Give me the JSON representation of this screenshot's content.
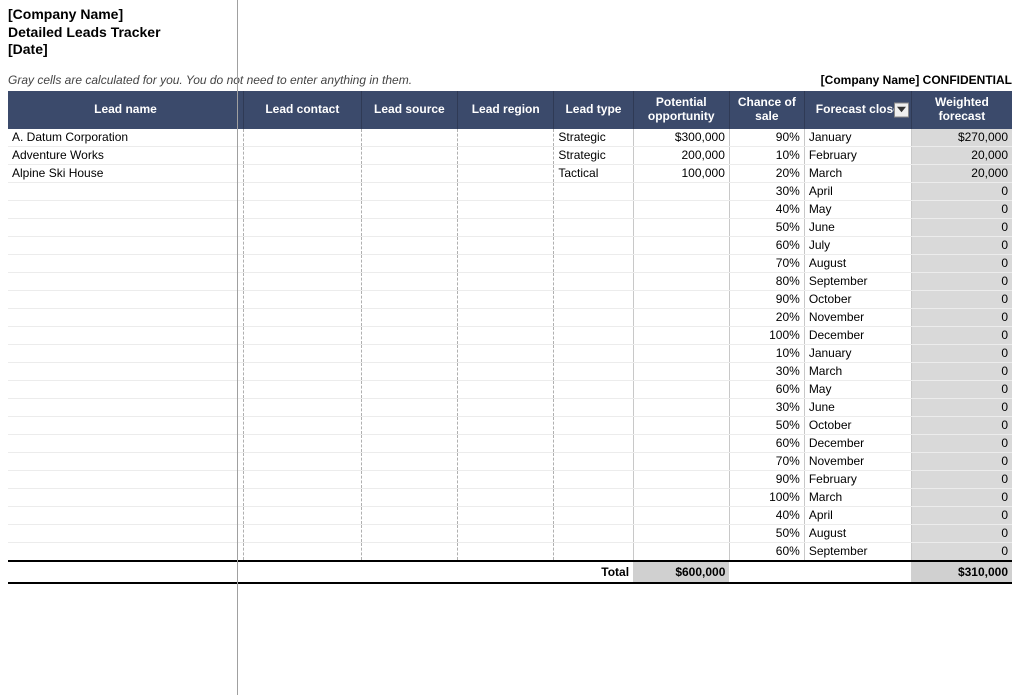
{
  "header": {
    "company": "[Company Name]",
    "title": "Detailed Leads Tracker",
    "date": "[Date]"
  },
  "note": "Gray cells are calculated for you. You do not need to enter anything in them.",
  "confidential": "[Company Name]   CONFIDENTIAL",
  "columns": {
    "name": "Lead\nname",
    "contact": "Lead\ncontact",
    "source": "Lead\nsource",
    "region": "Lead\nregion",
    "type": "Lead\ntype",
    "potential": "Potential\nopportunity",
    "chance": "Chance\nof sale",
    "close": "Forecast\nclose",
    "weighted": "Weighted\nforecast"
  },
  "rows": [
    {
      "name": "A. Datum Corporation",
      "contact": "",
      "source": "",
      "region": "",
      "type": "Strategic",
      "potential": "$300,000",
      "chance": "90%",
      "close": "January",
      "weighted": "$270,000"
    },
    {
      "name": "Adventure Works",
      "contact": "",
      "source": "",
      "region": "",
      "type": "Strategic",
      "potential": "200,000",
      "chance": "10%",
      "close": "February",
      "weighted": "20,000"
    },
    {
      "name": "Alpine Ski House",
      "contact": "",
      "source": "",
      "region": "",
      "type": "Tactical",
      "potential": "100,000",
      "chance": "20%",
      "close": "March",
      "weighted": "20,000"
    },
    {
      "name": "",
      "contact": "",
      "source": "",
      "region": "",
      "type": "",
      "potential": "",
      "chance": "30%",
      "close": "April",
      "weighted": "0"
    },
    {
      "name": "",
      "contact": "",
      "source": "",
      "region": "",
      "type": "",
      "potential": "",
      "chance": "40%",
      "close": "May",
      "weighted": "0"
    },
    {
      "name": "",
      "contact": "",
      "source": "",
      "region": "",
      "type": "",
      "potential": "",
      "chance": "50%",
      "close": "June",
      "weighted": "0"
    },
    {
      "name": "",
      "contact": "",
      "source": "",
      "region": "",
      "type": "",
      "potential": "",
      "chance": "60%",
      "close": "July",
      "weighted": "0"
    },
    {
      "name": "",
      "contact": "",
      "source": "",
      "region": "",
      "type": "",
      "potential": "",
      "chance": "70%",
      "close": "August",
      "weighted": "0"
    },
    {
      "name": "",
      "contact": "",
      "source": "",
      "region": "",
      "type": "",
      "potential": "",
      "chance": "80%",
      "close": "September",
      "weighted": "0"
    },
    {
      "name": "",
      "contact": "",
      "source": "",
      "region": "",
      "type": "",
      "potential": "",
      "chance": "90%",
      "close": "October",
      "weighted": "0"
    },
    {
      "name": "",
      "contact": "",
      "source": "",
      "region": "",
      "type": "",
      "potential": "",
      "chance": "20%",
      "close": "November",
      "weighted": "0"
    },
    {
      "name": "",
      "contact": "",
      "source": "",
      "region": "",
      "type": "",
      "potential": "",
      "chance": "100%",
      "close": "December",
      "weighted": "0"
    },
    {
      "name": "",
      "contact": "",
      "source": "",
      "region": "",
      "type": "",
      "potential": "",
      "chance": "10%",
      "close": "January",
      "weighted": "0"
    },
    {
      "name": "",
      "contact": "",
      "source": "",
      "region": "",
      "type": "",
      "potential": "",
      "chance": "30%",
      "close": "March",
      "weighted": "0"
    },
    {
      "name": "",
      "contact": "",
      "source": "",
      "region": "",
      "type": "",
      "potential": "",
      "chance": "60%",
      "close": "May",
      "weighted": "0"
    },
    {
      "name": "",
      "contact": "",
      "source": "",
      "region": "",
      "type": "",
      "potential": "",
      "chance": "30%",
      "close": "June",
      "weighted": "0"
    },
    {
      "name": "",
      "contact": "",
      "source": "",
      "region": "",
      "type": "",
      "potential": "",
      "chance": "50%",
      "close": "October",
      "weighted": "0"
    },
    {
      "name": "",
      "contact": "",
      "source": "",
      "region": "",
      "type": "",
      "potential": "",
      "chance": "60%",
      "close": "December",
      "weighted": "0"
    },
    {
      "name": "",
      "contact": "",
      "source": "",
      "region": "",
      "type": "",
      "potential": "",
      "chance": "70%",
      "close": "November",
      "weighted": "0"
    },
    {
      "name": "",
      "contact": "",
      "source": "",
      "region": "",
      "type": "",
      "potential": "",
      "chance": "90%",
      "close": "February",
      "weighted": "0"
    },
    {
      "name": "",
      "contact": "",
      "source": "",
      "region": "",
      "type": "",
      "potential": "",
      "chance": "100%",
      "close": "March",
      "weighted": "0"
    },
    {
      "name": "",
      "contact": "",
      "source": "",
      "region": "",
      "type": "",
      "potential": "",
      "chance": "40%",
      "close": "April",
      "weighted": "0"
    },
    {
      "name": "",
      "contact": "",
      "source": "",
      "region": "",
      "type": "",
      "potential": "",
      "chance": "50%",
      "close": "August",
      "weighted": "0"
    },
    {
      "name": "",
      "contact": "",
      "source": "",
      "region": "",
      "type": "",
      "potential": "",
      "chance": "60%",
      "close": "September",
      "weighted": "0"
    }
  ],
  "totals": {
    "label": "Total",
    "potential": "$600,000",
    "weighted": "$310,000"
  }
}
